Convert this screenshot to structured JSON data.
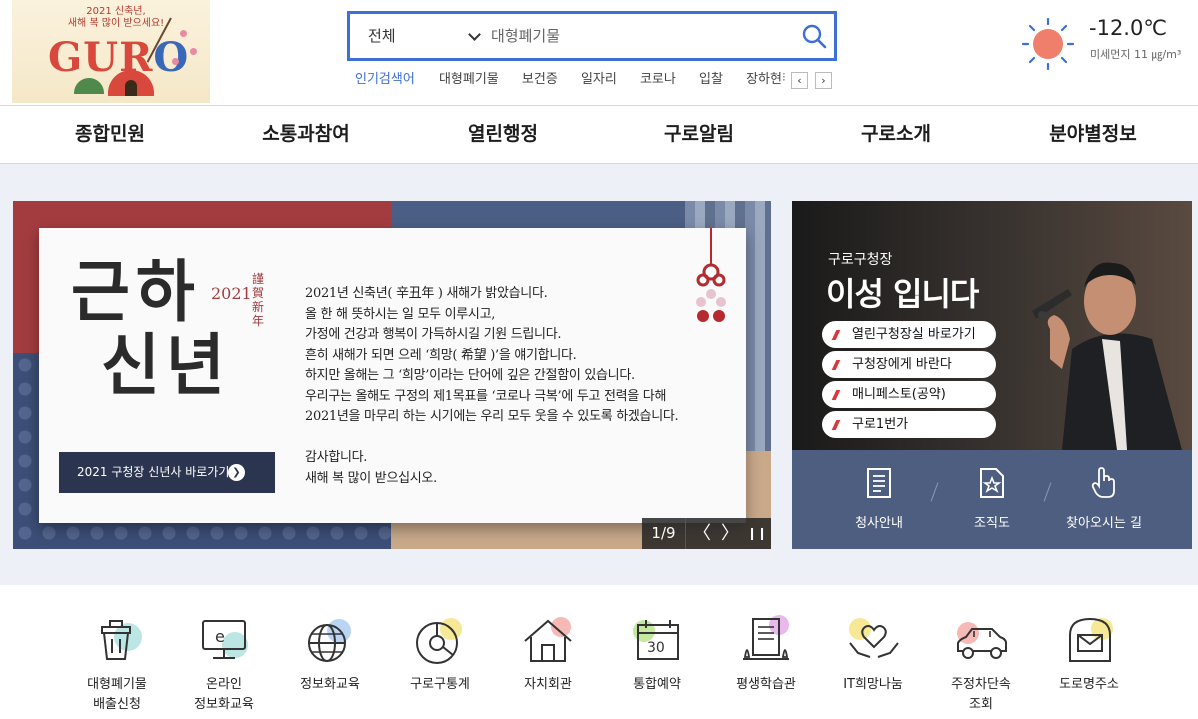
{
  "header": {
    "logo_subtitle_line1": "2021 신축년,",
    "logo_subtitle_line2": "새해 복 많이 받으세요!",
    "logo_word_g": "G",
    "logo_word_u": "U",
    "logo_word_r": "R",
    "logo_word_o": "O",
    "search": {
      "scope_selected": "전체",
      "placeholder": "대형폐기물",
      "search_icon": "search-icon"
    },
    "popular": {
      "title": "인기검색어",
      "keywords": [
        "대형폐기물",
        "보건증",
        "일자리",
        "코로나",
        "입찰",
        "장하현"
      ],
      "prev_label": "‹",
      "next_label": "›",
      "more_label": "⁝"
    },
    "weather": {
      "icon": "sun-icon",
      "temperature": "-12.0℃",
      "fine_dust": "미세먼지 11 ㎍/m³"
    }
  },
  "gnb": {
    "items": [
      "종합민원",
      "소통과참여",
      "열린행정",
      "구로알림",
      "구로소개",
      "분야별정보"
    ]
  },
  "banner": {
    "hangul_art_line1": "근하",
    "hangul_art_line2": "신년",
    "year": "2021",
    "seal": "謹賀新年",
    "message": "2021년 신축년( 辛丑年 ) 새해가 밝았습니다.\n올 한 해 뜻하시는 일 모두 이루시고,\n가정에 건강과 행복이 가득하시길 기원 드립니다.\n흔히 새해가 되면 으레 ‘희망( 希望 )’을 얘기합니다.\n하지만 올해는 그 ‘희망’이라는 단어에 깊은 간절함이 있습니다.\n우리구는 올해도 구정의 제1목표를 ‘코로나 극복’에 두고 전력을 다해\n2021년을 마무리 하는 시기에는 우리 모두 웃을 수 있도록 하겠습니다.\n\n감사합니다.\n새해 복 많이 받으십시오.",
    "button_label": "2021 구청장 신년사 바로가기",
    "slide_counter": "1/9",
    "prev_label": "〈",
    "next_label": "〉",
    "pause_label": "❙❙"
  },
  "mayor": {
    "subtitle": "구로구청장",
    "name": "이성 입니다",
    "links": [
      "열린구청장실 바로가기",
      "구청장에게 바란다",
      "매니페스토(공약)",
      "구로1번가"
    ],
    "bottom_items": [
      {
        "label": "청사안내",
        "icon": "document-icon"
      },
      {
        "label": "조직도",
        "icon": "org-chart-icon"
      },
      {
        "label": "찾아오시는 길",
        "icon": "hand-pointer-icon"
      }
    ]
  },
  "quick_menu": {
    "items": [
      {
        "label": "대형폐기물\n배출신청",
        "icon": "trash-bin-icon",
        "accent": "#8fd6d0"
      },
      {
        "label": "온라인\n정보화교육",
        "icon": "monitor-e-icon",
        "accent": "#8fd6d0"
      },
      {
        "label": "정보화교육",
        "icon": "globe-icon",
        "accent": "#9bc3ee"
      },
      {
        "label": "구로구통계",
        "icon": "pie-chart-icon",
        "accent": "#f4e27a"
      },
      {
        "label": "자치회관",
        "icon": "house-icon",
        "accent": "#f5a8a3"
      },
      {
        "label": "통합예약",
        "icon": "calendar-icon",
        "accent": "#b6e28a"
      },
      {
        "label": "평생학습관",
        "icon": "book-icon",
        "accent": "#e3a7e6"
      },
      {
        "label": "IT희망나눔",
        "icon": "heart-hands-icon",
        "accent": "#f4e27a"
      },
      {
        "label": "주정차단속\n조회",
        "icon": "car-icon",
        "accent": "#f5a8a3"
      },
      {
        "label": "도로명주소",
        "icon": "mailbox-icon",
        "accent": "#f4e27a"
      }
    ]
  },
  "colors": {
    "accent_blue": "#3d6fd6",
    "banner_red": "#a33c3f",
    "panel_blue": "#4e5e80",
    "link_mark_red": "#d8383b"
  }
}
